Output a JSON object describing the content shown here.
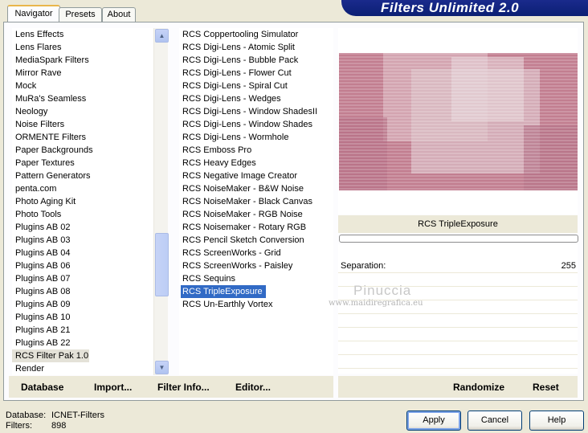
{
  "app": {
    "title": "Filters Unlimited 2.0"
  },
  "tabs": [
    {
      "label": "Navigator"
    },
    {
      "label": "Presets"
    },
    {
      "label": "About"
    }
  ],
  "categories": [
    "Lens Effects",
    "Lens Flares",
    "MediaSpark Filters",
    "Mirror Rave",
    "Mock",
    "MuRa's Seamless",
    "Neology",
    "Noise Filters",
    "ORMENTE Filters",
    "Paper Backgrounds",
    "Paper Textures",
    "Pattern Generators",
    "penta.com",
    "Photo Aging Kit",
    "Photo Tools",
    "Plugins AB 02",
    "Plugins AB 03",
    "Plugins AB 04",
    "Plugins AB 06",
    "Plugins AB 07",
    "Plugins AB 08",
    "Plugins AB 09",
    "Plugins AB 10",
    "Plugins AB 21",
    "Plugins AB 22",
    "RCS Filter Pak 1.0",
    "Render"
  ],
  "filters": [
    "RCS Coppertooling Simulator",
    "RCS Digi-Lens - Atomic Split",
    "RCS Digi-Lens - Bubble Pack",
    "RCS Digi-Lens - Flower Cut",
    "RCS Digi-Lens - Spiral Cut",
    "RCS Digi-Lens - Wedges",
    "RCS Digi-Lens - Window ShadesII",
    "RCS Digi-Lens - Window Shades",
    "RCS Digi-Lens - Wormhole",
    "RCS Emboss Pro",
    "RCS Heavy Edges",
    "RCS Negative Image Creator",
    "RCS NoiseMaker - B&W Noise",
    "RCS NoiseMaker - Black Canvas",
    "RCS NoiseMaker - RGB Noise",
    "RCS Noisemaker - Rotary RGB",
    "RCS Pencil Sketch Conversion",
    "RCS ScreenWorks - Grid",
    "RCS ScreenWorks - Paisley",
    "RCS Sequins",
    "RCS TripleExposure",
    "RCS Un-Earthly Vortex"
  ],
  "selected_category": "RCS Filter Pak 1.0",
  "selected_filter": "RCS TripleExposure",
  "preview": {
    "filter_name": "RCS TripleExposure"
  },
  "params": [
    {
      "label": "Separation:",
      "value": "255"
    }
  ],
  "watermark": {
    "name": "Pinuccia",
    "url": "www.maidiregrafica.eu"
  },
  "toolbar": {
    "database": "Database",
    "import": "Import...",
    "filter_info": "Filter Info...",
    "editor": "Editor...",
    "randomize": "Randomize",
    "reset": "Reset"
  },
  "status": {
    "database_label": "Database:",
    "database_value": "ICNET-Filters",
    "filters_label": "Filters:",
    "filters_value": "898"
  },
  "buttons": {
    "apply": "Apply",
    "cancel": "Cancel",
    "help": "Help"
  },
  "colors": {
    "selection": "#316ac5",
    "banner": "#0b1f74",
    "preview_tint": "#c27e90"
  }
}
